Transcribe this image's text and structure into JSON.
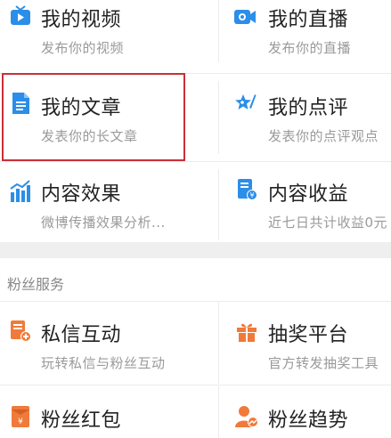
{
  "grid_top": [
    {
      "id": "my-videos",
      "title": "我的视频",
      "sub": "发布你的视频",
      "icon": "tv-icon"
    },
    {
      "id": "my-live",
      "title": "我的直播",
      "sub": "发布你的直播",
      "icon": "camera-icon"
    },
    {
      "id": "my-articles",
      "title": "我的文章",
      "sub": "发表你的长文章",
      "icon": "document-icon"
    },
    {
      "id": "my-reviews",
      "title": "我的点评",
      "sub": "发表你的点评观点",
      "icon": "star-pen-icon"
    },
    {
      "id": "content-effect",
      "title": "内容效果",
      "sub": "微博传播效果分析...",
      "icon": "bar-chart-icon"
    },
    {
      "id": "content-revenue",
      "title": "内容收益",
      "sub": "近七日共计收益0元",
      "icon": "revenue-doc-icon"
    }
  ],
  "fans_section": {
    "title": "粉丝服务",
    "items": [
      {
        "id": "private-msg",
        "title": "私信互动",
        "sub": "玩转私信与粉丝互动",
        "icon": "message-plus-icon"
      },
      {
        "id": "lottery",
        "title": "抽奖平台",
        "sub": "官方转发抽奖工具",
        "icon": "gift-icon"
      },
      {
        "id": "fans-redpack",
        "title": "粉丝红包",
        "sub": "",
        "icon": "red-envelope-icon"
      },
      {
        "id": "fans-trend",
        "title": "粉丝趋势",
        "sub": "",
        "icon": "user-trend-icon"
      }
    ]
  },
  "colors": {
    "blue": "#2b8ee8",
    "orange": "#f07a3a",
    "highlight": "#c8303a"
  }
}
